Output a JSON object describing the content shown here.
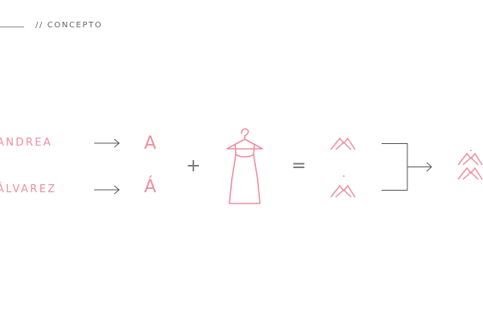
{
  "header": {
    "label": "// CONCEPTO"
  },
  "names": {
    "first": "ANDREA",
    "second": "ÁLVAREZ"
  },
  "letters": {
    "first": "A",
    "second": "Á"
  },
  "operators": {
    "plus": "+",
    "equals": "="
  },
  "colors": {
    "accent": "#ef8f9f",
    "gray": "#666666",
    "arrow": "#555555"
  },
  "icons": [
    "right-arrow-icon",
    "dress-hanger-icon",
    "triangle-a-icon",
    "bracket-arrow-icon",
    "monogram-logo-icon"
  ]
}
